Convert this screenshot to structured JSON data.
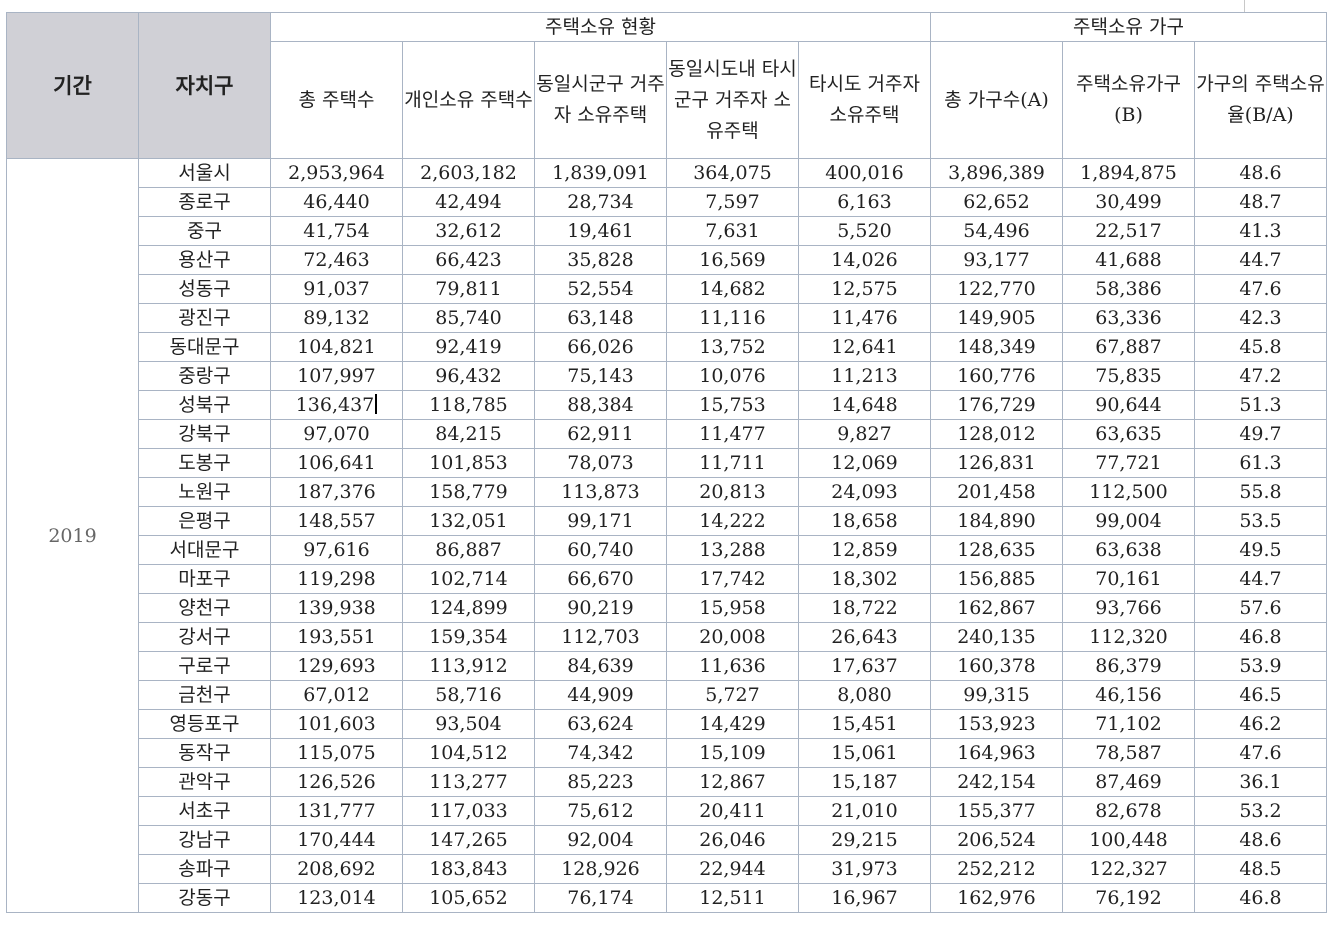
{
  "table": {
    "header_period": "기간",
    "header_district": "자치구",
    "group_ownership": "주택소유 현황",
    "group_household": "주택소유 가구",
    "columns": [
      "총 주택수",
      "개인소유 주택수",
      "동일시군구 거주자 소유주택",
      "동일시도내 타시군구 거주자 소유주택",
      "타시도 거주자 소유주택",
      "총 가구수(A)",
      "주택소유가구(B)",
      "가구의 주택소유율(B/A)"
    ],
    "period": "2019",
    "rows": [
      [
        "서울시",
        "2,953,964",
        "2,603,182",
        "1,839,091",
        "364,075",
        "400,016",
        "3,896,389",
        "1,894,875",
        "48.6"
      ],
      [
        "종로구",
        "46,440",
        "42,494",
        "28,734",
        "7,597",
        "6,163",
        "62,652",
        "30,499",
        "48.7"
      ],
      [
        "중구",
        "41,754",
        "32,612",
        "19,461",
        "7,631",
        "5,520",
        "54,496",
        "22,517",
        "41.3"
      ],
      [
        "용산구",
        "72,463",
        "66,423",
        "35,828",
        "16,569",
        "14,026",
        "93,177",
        "41,688",
        "44.7"
      ],
      [
        "성동구",
        "91,037",
        "79,811",
        "52,554",
        "14,682",
        "12,575",
        "122,770",
        "58,386",
        "47.6"
      ],
      [
        "광진구",
        "89,132",
        "85,740",
        "63,148",
        "11,116",
        "11,476",
        "149,905",
        "63,336",
        "42.3"
      ],
      [
        "동대문구",
        "104,821",
        "92,419",
        "66,026",
        "13,752",
        "12,641",
        "148,349",
        "67,887",
        "45.8"
      ],
      [
        "중랑구",
        "107,997",
        "96,432",
        "75,143",
        "10,076",
        "11,213",
        "160,776",
        "75,835",
        "47.2"
      ],
      [
        "성북구",
        "136,437",
        "118,785",
        "88,384",
        "15,753",
        "14,648",
        "176,729",
        "90,644",
        "51.3"
      ],
      [
        "강북구",
        "97,070",
        "84,215",
        "62,911",
        "11,477",
        "9,827",
        "128,012",
        "63,635",
        "49.7"
      ],
      [
        "도봉구",
        "106,641",
        "101,853",
        "78,073",
        "11,711",
        "12,069",
        "126,831",
        "77,721",
        "61.3"
      ],
      [
        "노원구",
        "187,376",
        "158,779",
        "113,873",
        "20,813",
        "24,093",
        "201,458",
        "112,500",
        "55.8"
      ],
      [
        "은평구",
        "148,557",
        "132,051",
        "99,171",
        "14,222",
        "18,658",
        "184,890",
        "99,004",
        "53.5"
      ],
      [
        "서대문구",
        "97,616",
        "86,887",
        "60,740",
        "13,288",
        "12,859",
        "128,635",
        "63,638",
        "49.5"
      ],
      [
        "마포구",
        "119,298",
        "102,714",
        "66,670",
        "17,742",
        "18,302",
        "156,885",
        "70,161",
        "44.7"
      ],
      [
        "양천구",
        "139,938",
        "124,899",
        "90,219",
        "15,958",
        "18,722",
        "162,867",
        "93,766",
        "57.6"
      ],
      [
        "강서구",
        "193,551",
        "159,354",
        "112,703",
        "20,008",
        "26,643",
        "240,135",
        "112,320",
        "46.8"
      ],
      [
        "구로구",
        "129,693",
        "113,912",
        "84,639",
        "11,636",
        "17,637",
        "160,378",
        "86,379",
        "53.9"
      ],
      [
        "금천구",
        "67,012",
        "58,716",
        "44,909",
        "5,727",
        "8,080",
        "99,315",
        "46,156",
        "46.5"
      ],
      [
        "영등포구",
        "101,603",
        "93,504",
        "63,624",
        "14,429",
        "15,451",
        "153,923",
        "71,102",
        "46.2"
      ],
      [
        "동작구",
        "115,075",
        "104,512",
        "74,342",
        "15,109",
        "15,061",
        "164,963",
        "78,587",
        "47.6"
      ],
      [
        "관악구",
        "126,526",
        "113,277",
        "85,223",
        "12,867",
        "15,187",
        "242,154",
        "87,469",
        "36.1"
      ],
      [
        "서초구",
        "131,777",
        "117,033",
        "75,612",
        "20,411",
        "21,010",
        "155,377",
        "82,678",
        "53.2"
      ],
      [
        "강남구",
        "170,444",
        "147,265",
        "92,004",
        "26,046",
        "29,215",
        "206,524",
        "100,448",
        "48.6"
      ],
      [
        "송파구",
        "208,692",
        "183,843",
        "128,926",
        "22,944",
        "31,973",
        "252,212",
        "122,327",
        "48.5"
      ],
      [
        "강동구",
        "123,014",
        "105,652",
        "76,174",
        "12,511",
        "16,967",
        "162,976",
        "76,192",
        "46.8"
      ]
    ]
  }
}
